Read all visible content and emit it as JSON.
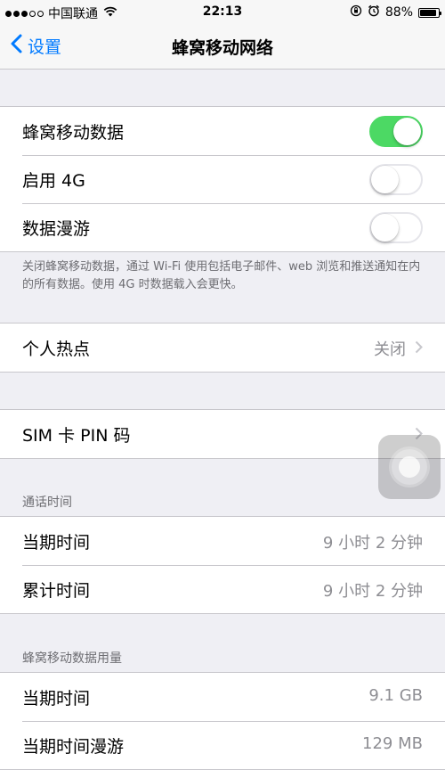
{
  "status_bar": {
    "carrier": "中国联通",
    "time": "22:13",
    "battery_percent": "88%",
    "battery_level": 0.88,
    "icons": [
      "signal-dots-icon",
      "wifi-icon",
      "orientation-lock-icon",
      "alarm-icon",
      "battery-icon"
    ]
  },
  "nav": {
    "back_label": "设置",
    "title": "蜂窝移动网络"
  },
  "cellular_group": {
    "rows": [
      {
        "label": "蜂窝移动数据",
        "toggle": "on"
      },
      {
        "label": "启用 4G",
        "toggle": "off"
      },
      {
        "label": "数据漫游",
        "toggle": "off"
      }
    ],
    "footer": "关闭蜂窝移动数据，通过 Wi-Fi 使用包括电子邮件、web 浏览和推送通知在内的所有数据。使用 4G 时数据载入会更快。"
  },
  "hotspot": {
    "label": "个人热点",
    "value": "关闭"
  },
  "sim": {
    "label": "SIM 卡 PIN 码"
  },
  "call_time": {
    "header": "通话时间",
    "rows": [
      {
        "label": "当期时间",
        "value": "9 小时 2 分钟"
      },
      {
        "label": "累计时间",
        "value": "9 小时 2 分钟"
      }
    ]
  },
  "data_usage": {
    "header": "蜂窝移动数据用量",
    "rows": [
      {
        "label": "当期时间",
        "value": "9.1 GB"
      },
      {
        "label": "当期时间漫游",
        "value": "129 MB"
      }
    ]
  },
  "colors": {
    "accent": "#007aff",
    "toggle_on": "#4cd964",
    "background": "#efeff4"
  }
}
